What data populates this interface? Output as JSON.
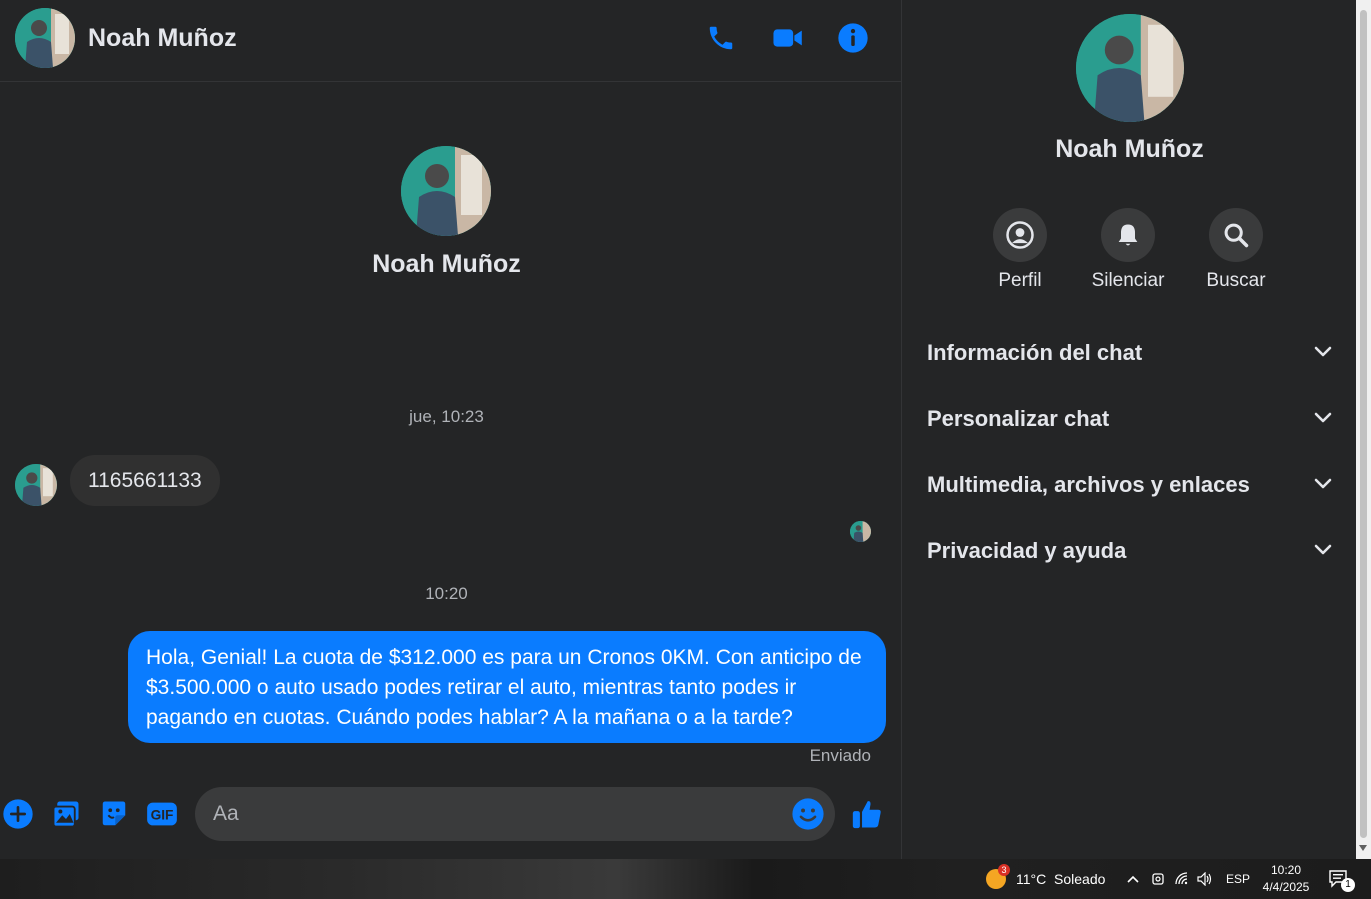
{
  "contact": {
    "name": "Noah Muñoz"
  },
  "header": {
    "call_icon": "phone-icon",
    "video_icon": "video-camera-icon",
    "info_icon": "info-icon"
  },
  "messages": {
    "timestamp_1": "jue, 10:23",
    "incoming_text": "1165661133",
    "timestamp_2": "10:20",
    "outgoing_text": "Hola, Genial! La cuota de $312.000 es para un Cronos 0KM. Con anticipo de $3.500.000 o auto usado podes retirar el auto, mientras tanto podes ir pagando en cuotas. Cuándo podes hablar? A la mañana o a la tarde?",
    "status": "Enviado"
  },
  "composer": {
    "placeholder": "Aa",
    "value": ""
  },
  "panel": {
    "actions": [
      {
        "label": "Perfil",
        "icon": "profile-icon"
      },
      {
        "label": "Silenciar",
        "icon": "bell-icon"
      },
      {
        "label": "Buscar",
        "icon": "search-icon"
      }
    ],
    "sections": [
      {
        "title": "Información del chat"
      },
      {
        "title": "Personalizar chat"
      },
      {
        "title": "Multimedia, archivos y enlaces"
      },
      {
        "title": "Privacidad y ayuda"
      }
    ]
  },
  "taskbar": {
    "weather_badge": "3",
    "weather": "11°C  Soleado",
    "language": "ESP",
    "time": "10:20",
    "date": "4/4/2025",
    "notifications": "1"
  },
  "colors": {
    "accent": "#0a7cff",
    "background": "#242526",
    "bubble_incoming": "#303030",
    "input_bg": "#3a3b3c"
  }
}
